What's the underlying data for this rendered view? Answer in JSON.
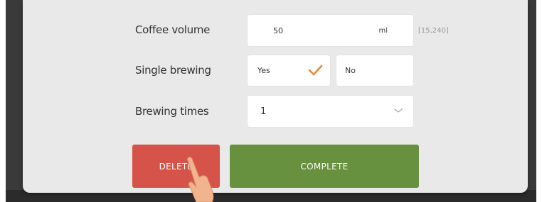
{
  "form": {
    "coffee_volume": {
      "label": "Coffee volume",
      "value": "50",
      "unit": "ml",
      "range_hint": "[15,240]"
    },
    "single_brewing": {
      "label": "Single brewing",
      "options": [
        {
          "label": "Yes",
          "selected": true
        },
        {
          "label": "No",
          "selected": false
        }
      ]
    },
    "brewing_times": {
      "label": "Brewing times",
      "value": "1"
    }
  },
  "actions": {
    "delete_label": "DELETE",
    "complete_label": "COMPLETE"
  },
  "colors": {
    "delete": "#d55349",
    "complete": "#67903f",
    "check": "#e58a3c",
    "panel": "#e9e9e9"
  },
  "icons": {
    "selected_check": "check-icon",
    "select_arrow": "chevron-down-icon",
    "touch": "hand-pointer-icon"
  }
}
